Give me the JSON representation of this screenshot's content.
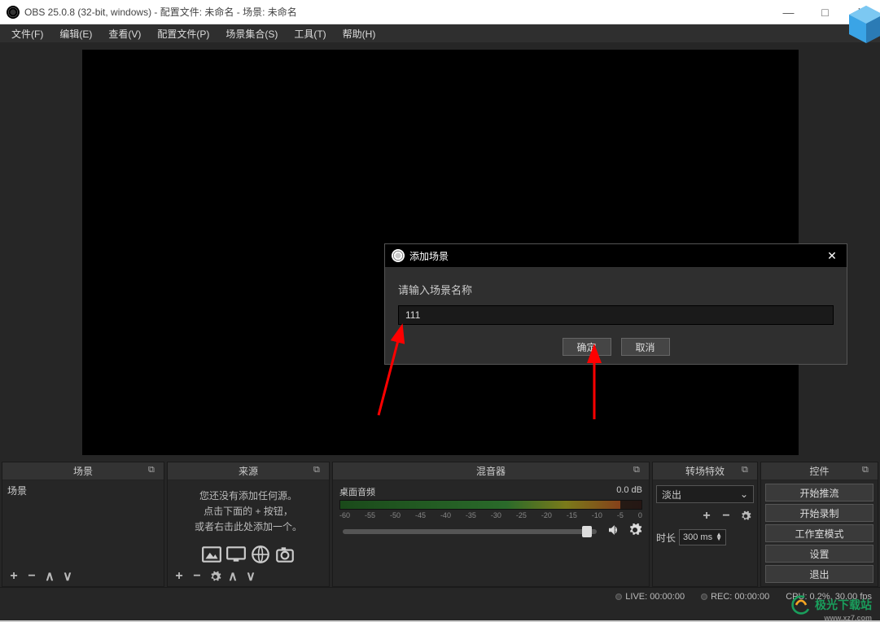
{
  "titlebar": {
    "title": "OBS 25.0.8 (32-bit, windows) - 配置文件: 未命名 - 场景: 未命名"
  },
  "menu": {
    "file": "文件(F)",
    "edit": "编辑(E)",
    "view": "查看(V)",
    "profile": "配置文件(P)",
    "scenes": "场景集合(S)",
    "tools": "工具(T)",
    "help": "帮助(H)"
  },
  "panels": {
    "scenes": {
      "title": "场景",
      "items": [
        "场景"
      ]
    },
    "sources": {
      "title": "来源",
      "msg_l1": "您还没有添加任何源。",
      "msg_l2": "点击下面的 + 按钮，",
      "msg_l3": "或者右击此处添加一个。"
    },
    "mixer": {
      "title": "混音器",
      "track": "桌面音频",
      "level": "0.0 dB",
      "ticks": [
        "-60",
        "-55",
        "-50",
        "-45",
        "-40",
        "-35",
        "-30",
        "-25",
        "-20",
        "-15",
        "-10",
        "-5",
        "0"
      ]
    },
    "trans": {
      "title": "转场特效",
      "mode": "淡出",
      "dur_lbl": "时长",
      "dur_val": "300 ms"
    },
    "ctrl": {
      "title": "控件",
      "btns": [
        "开始推流",
        "开始录制",
        "工作室模式",
        "设置",
        "退出"
      ]
    }
  },
  "status": {
    "live": "LIVE: 00:00:00",
    "rec": "REC: 00:00:00",
    "cpu": "CPU: 0.2%, 30.00 fps"
  },
  "dialog": {
    "title": "添加场景",
    "label": "请输入场景名称",
    "value": "111",
    "ok": "确定",
    "cancel": "取消"
  },
  "watermark": {
    "text": "极光下载站",
    "sub": "www.xz7.com"
  }
}
